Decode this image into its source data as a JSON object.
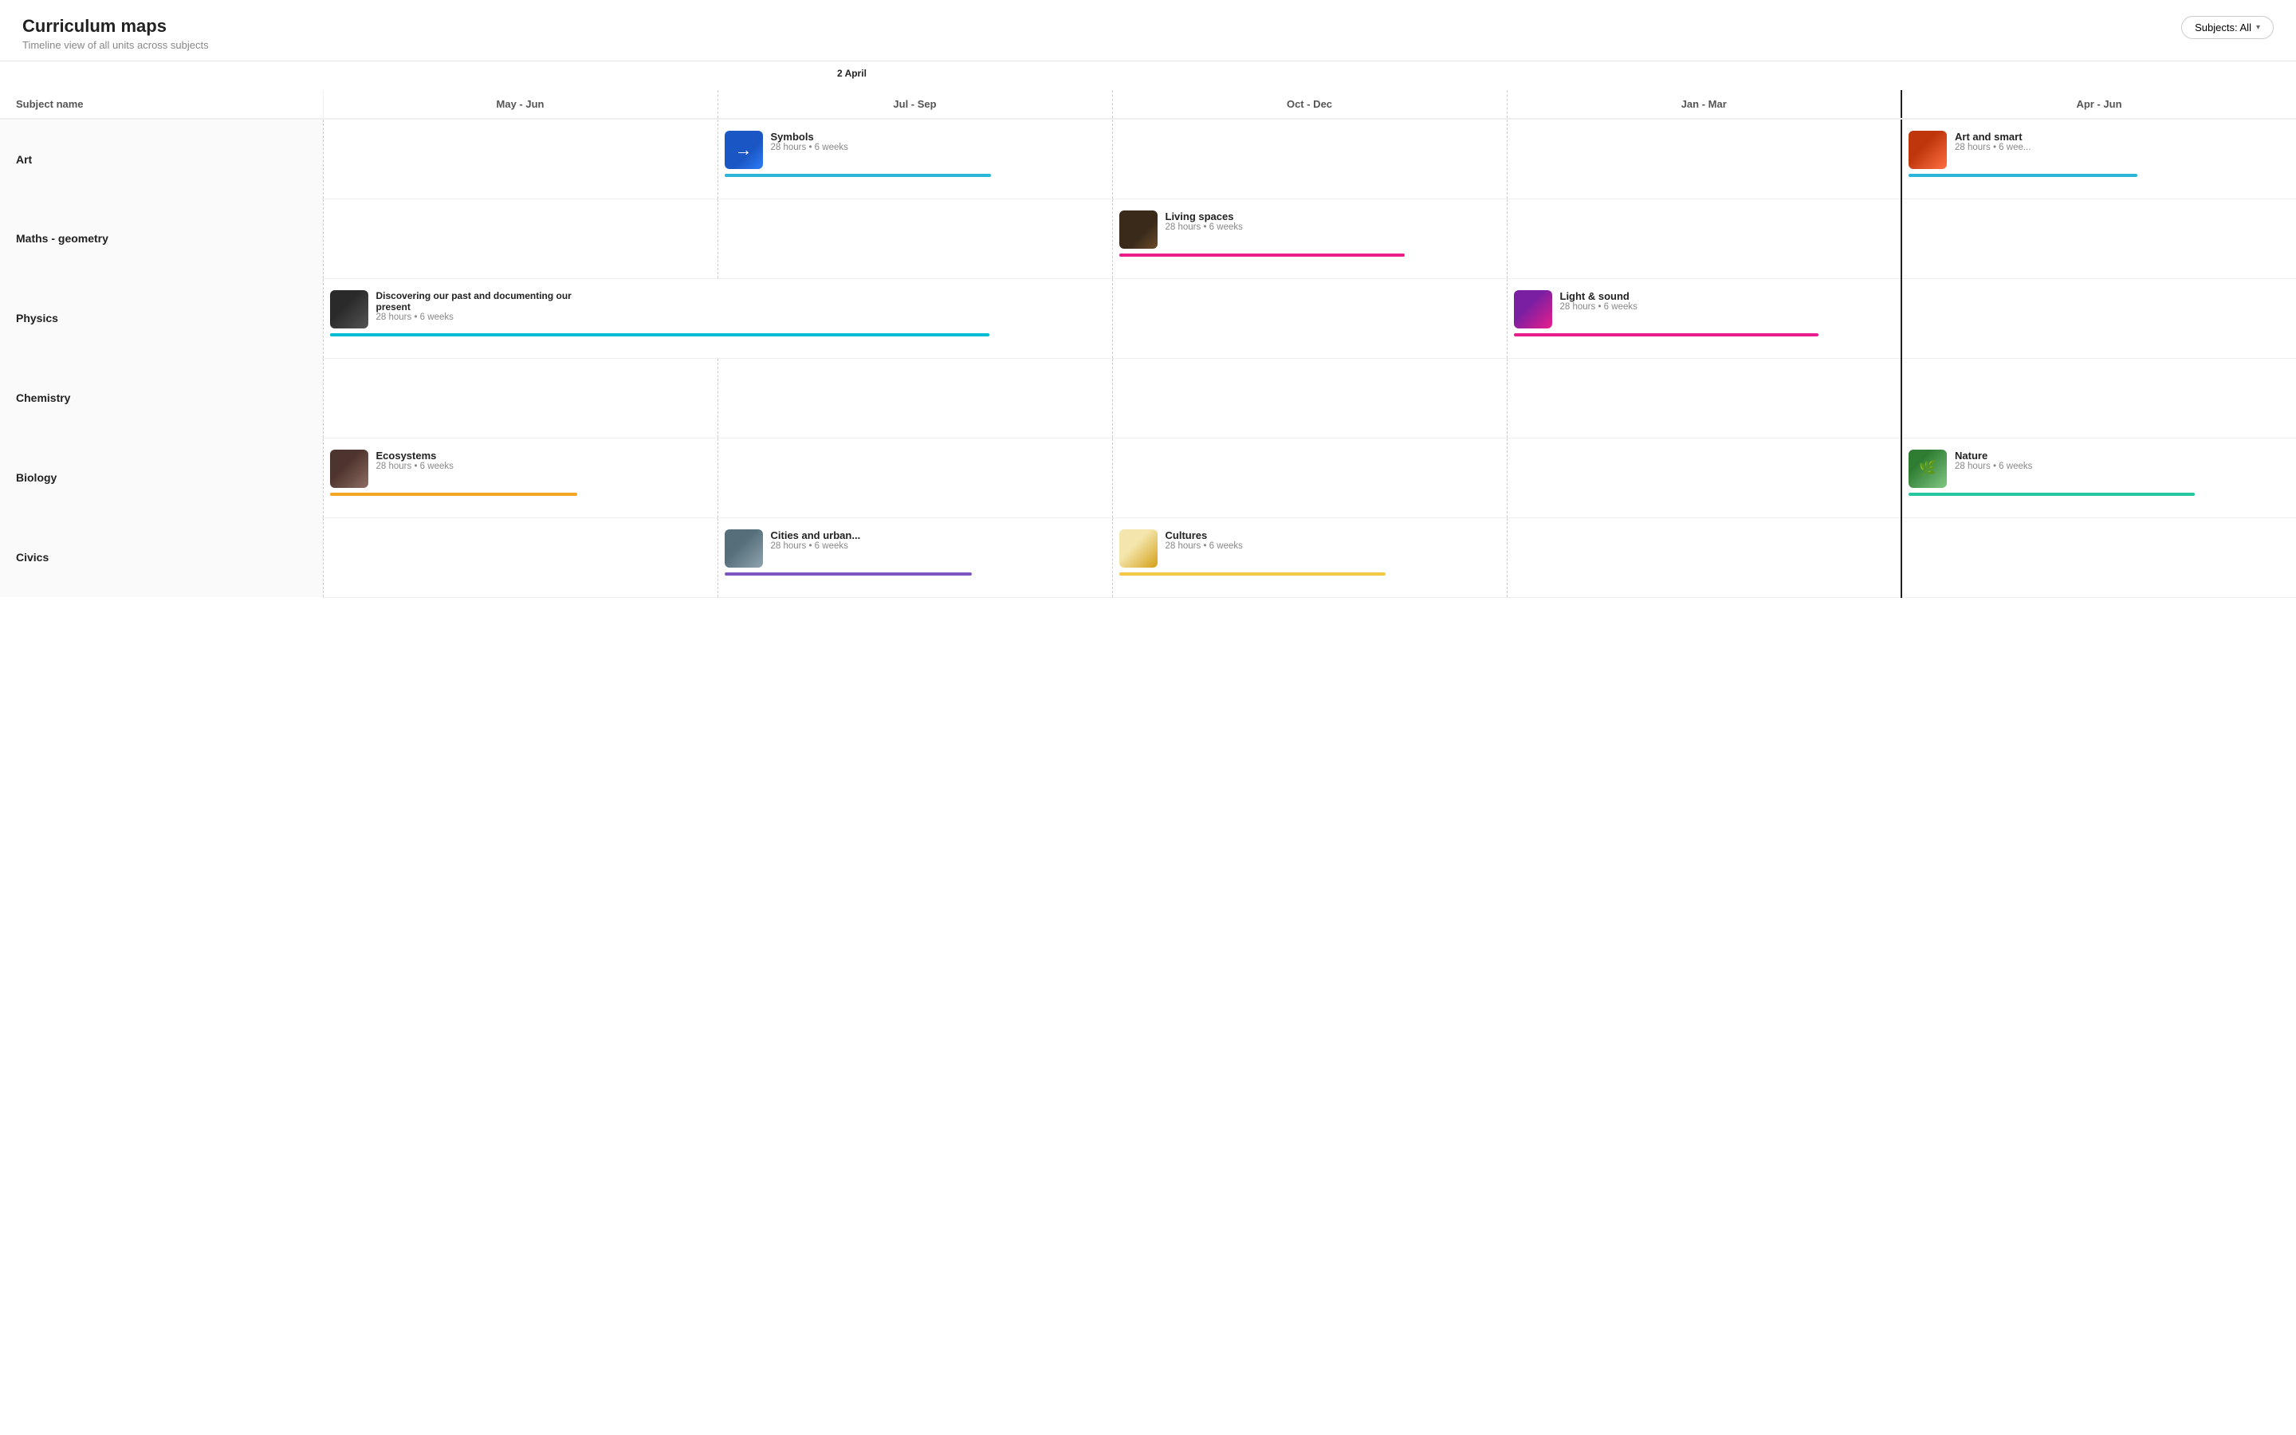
{
  "header": {
    "title": "Curriculum maps",
    "subtitle": "Timeline view of all units across subjects",
    "subjects_button": "Subjects: All"
  },
  "today_label": "2 April",
  "columns": [
    {
      "id": "subject",
      "label": "Subject name"
    },
    {
      "id": "may_jun",
      "label": "May - Jun"
    },
    {
      "id": "jul_sep",
      "label": "Jul - Sep"
    },
    {
      "id": "oct_dec",
      "label": "Oct - Dec"
    },
    {
      "id": "jan_mar",
      "label": "Jan - Mar"
    },
    {
      "id": "apr_jun",
      "label": "Apr - Jun"
    }
  ],
  "rows": [
    {
      "subject": "Art",
      "units": [
        {
          "title": "Symbols",
          "meta": "28 hours • 6 weeks",
          "col": "jul_sep",
          "col_span": 1,
          "bar_color": "#29b6d8",
          "bar_width": "70%",
          "thumb_class": "thumb-symbols",
          "thumb_icon": "→"
        },
        {
          "title": "Art and smart",
          "meta": "28 hours • 6 wee...",
          "col": "apr_jun",
          "col_span": 1,
          "bar_color": "#29b6d8",
          "bar_width": "60%",
          "thumb_class": "thumb-artsmart",
          "thumb_icon": ""
        }
      ]
    },
    {
      "subject": "Maths - geometry",
      "units": [
        {
          "title": "Living spaces",
          "meta": "28 hours • 6 weeks",
          "col": "oct_dec",
          "col_span": 1,
          "bar_color": "#e91e8c",
          "bar_width": "75%",
          "thumb_class": "thumb-living",
          "thumb_icon": ""
        }
      ]
    },
    {
      "subject": "Physics",
      "units": [
        {
          "title": "Discovering our past and documenting our present",
          "meta": "28 hours • 6 weeks",
          "col": "may_jun",
          "col_span": 2,
          "bar_color": "#00bcd4",
          "bar_width": "85%",
          "thumb_class": "thumb-discovering",
          "thumb_icon": ""
        },
        {
          "title": "Light & sound",
          "meta": "28 hours • 6 weeks",
          "col": "jan_mar",
          "col_span": 1,
          "bar_color": "#e91e8c",
          "bar_width": "80%",
          "thumb_class": "thumb-lightsound",
          "thumb_icon": ""
        }
      ]
    },
    {
      "subject": "Chemistry",
      "units": []
    },
    {
      "subject": "Biology",
      "units": [
        {
          "title": "Ecosystems",
          "meta": "28 hours • 6 weeks",
          "col": "may_jun",
          "col_span": 1,
          "bar_color": "#f5a623",
          "bar_width": "65%",
          "thumb_class": "thumb-ecosystems",
          "thumb_icon": ""
        },
        {
          "title": "Nature",
          "meta": "28 hours • 6 weeks",
          "col": "apr_jun",
          "col_span": 1,
          "bar_color": "#26c6a0",
          "bar_width": "75%",
          "thumb_class": "thumb-nature",
          "thumb_icon": "🌿"
        }
      ]
    },
    {
      "subject": "Civics",
      "units": [
        {
          "title": "Cities and urban...",
          "meta": "28 hours • 6 weeks",
          "col": "jul_sep",
          "col_span": 1,
          "bar_color": "#7e57c2",
          "bar_width": "65%",
          "thumb_class": "thumb-cities",
          "thumb_icon": ""
        },
        {
          "title": "Cultures",
          "meta": "28 hours • 6 weeks",
          "col": "oct_dec",
          "col_span": 1,
          "bar_color": "#f5c842",
          "bar_width": "70%",
          "thumb_class": "thumb-cultures",
          "thumb_icon": ""
        }
      ]
    }
  ]
}
